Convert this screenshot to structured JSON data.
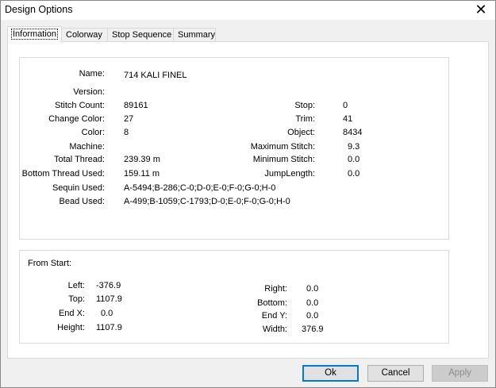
{
  "window": {
    "title": "Design Options",
    "close_glyph": "✕"
  },
  "tabs": [
    {
      "label": "Information"
    },
    {
      "label": "Colorway"
    },
    {
      "label": "Stop Sequence"
    },
    {
      "label": "Summary"
    }
  ],
  "info": {
    "name": {
      "label": "Name:",
      "value": "714 KALI FINEL"
    },
    "version": {
      "label": "Version:",
      "value": ""
    },
    "stitch_count": {
      "label": "Stitch Count:",
      "value": "89161"
    },
    "change_color": {
      "label": "Change Color:",
      "value": "27"
    },
    "color": {
      "label": "Color:",
      "value": "8"
    },
    "machine": {
      "label": "Machine:",
      "value": ""
    },
    "total_thread": {
      "label": "Total Thread:",
      "value": "239.39 m"
    },
    "bottom_thread": {
      "label": "Bottom Thread Used:",
      "value": "159.11 m"
    },
    "sequin": {
      "label": "Sequin Used:",
      "value": "A-5494;B-286;C-0;D-0;E-0;F-0;G-0;H-0"
    },
    "bead": {
      "label": "Bead Used:",
      "value": "A-499;B-1059;C-1793;D-0;E-0;F-0;G-0;H-0"
    },
    "stop": {
      "label": "Stop:",
      "value": "0"
    },
    "trim": {
      "label": "Trim:",
      "value": "41"
    },
    "object": {
      "label": "Object:",
      "value": "8434"
    },
    "max_stitch": {
      "label": "Maximum Stitch:",
      "value": "9.3"
    },
    "min_stitch": {
      "label": "Minimum Stitch:",
      "value": "0.0"
    },
    "jump_length": {
      "label": "JumpLength:",
      "value": "0.0"
    }
  },
  "from_start": {
    "heading": "From Start:",
    "left": {
      "label": "Left:",
      "value": "-376.9"
    },
    "top": {
      "label": "Top:",
      "value": "1107.9"
    },
    "end_x": {
      "label": "End X:",
      "value": "0.0"
    },
    "height": {
      "label": "Height:",
      "value": "1107.9"
    },
    "right": {
      "label": "Right:",
      "value": "0.0"
    },
    "bottom": {
      "label": "Bottom:",
      "value": "0.0"
    },
    "end_y": {
      "label": "End Y:",
      "value": "0.0"
    },
    "width": {
      "label": "Width:",
      "value": "376.9"
    }
  },
  "buttons": {
    "ok": "Ok",
    "cancel": "Cancel",
    "apply": "Apply"
  }
}
